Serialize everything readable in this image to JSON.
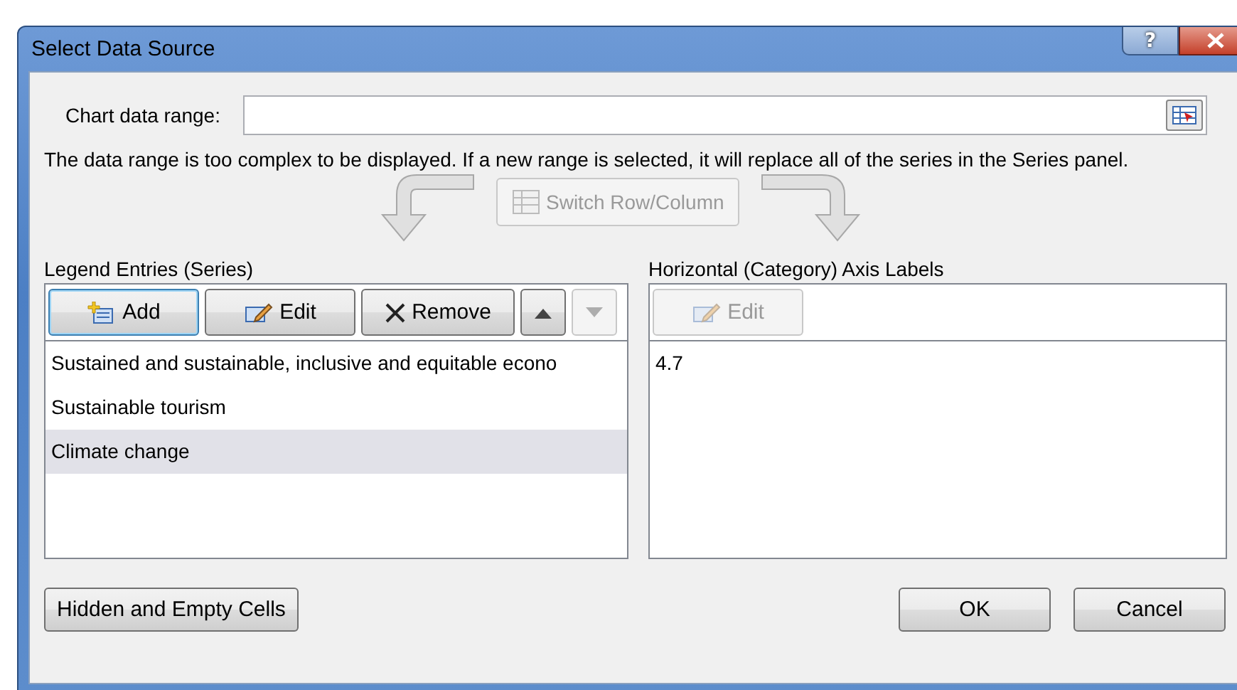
{
  "window": {
    "title": "Select Data Source",
    "help_button": "?"
  },
  "chart_data_range": {
    "label": "Chart data range:"
  },
  "message": "The data range is too complex to be displayed. If a new range is selected, it will replace all of the series in the Series panel.",
  "switch_button": {
    "label": "Switch Row/Column",
    "disabled": true
  },
  "legend": {
    "label": "Legend Entries (Series)",
    "buttons": [
      {
        "kind": "add",
        "label": "Add",
        "disabled": false
      },
      {
        "kind": "edit",
        "label": "Edit",
        "disabled": false
      },
      {
        "kind": "remove",
        "label": "Remove",
        "disabled": false
      },
      {
        "kind": "up",
        "disabled": false
      },
      {
        "kind": "down",
        "disabled": true
      }
    ],
    "items": [
      {
        "label": "Sustained and sustainable, inclusive and equitable econo",
        "selected": false
      },
      {
        "label": "Sustainable tourism",
        "selected": false
      },
      {
        "label": "Climate change",
        "selected": true
      }
    ]
  },
  "axis": {
    "label": "Horizontal (Category) Axis Labels",
    "buttons": [
      {
        "kind": "edit",
        "label": "Edit",
        "disabled": true
      }
    ],
    "items": [
      {
        "label": "4.7",
        "selected": false
      }
    ]
  },
  "footer_buttons": [
    {
      "kind": "left",
      "label": "Hidden and Empty Cells"
    },
    {
      "kind": "right",
      "label": "OK"
    },
    {
      "kind": "right",
      "label": "Cancel"
    }
  ]
}
